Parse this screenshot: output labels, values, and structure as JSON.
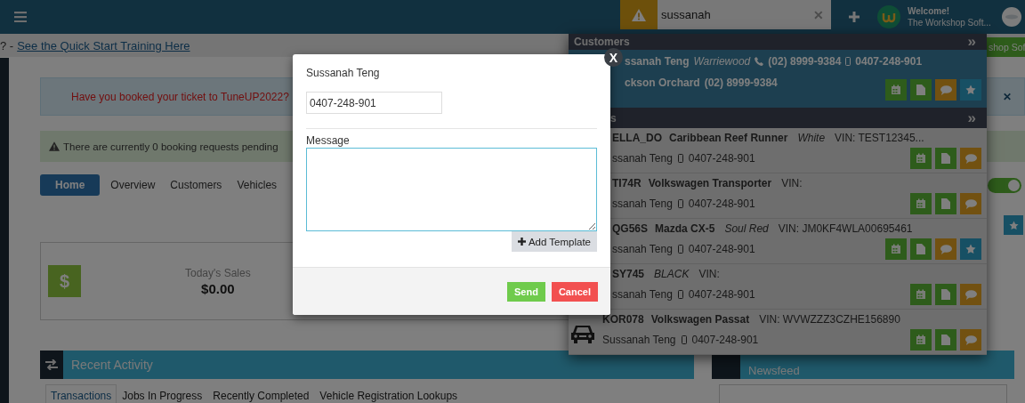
{
  "header": {
    "search": {
      "value": "sussanah",
      "clear": "✕"
    },
    "welcome": "Welcome!",
    "organisation": "The Workshop Soft..."
  },
  "banner": {
    "prefix": "? -",
    "link": "See the Quick Start Training Here",
    "button": "shop Sof"
  },
  "alerts": [
    {
      "kind": "info",
      "text": "Have you booked your ticket to TuneUP2022?",
      "close": "✕"
    },
    {
      "kind": "success",
      "text": "There are currently 0 booking requests pending"
    }
  ],
  "tabs": [
    {
      "label": "Home",
      "selected": true
    },
    {
      "label": "Overview",
      "selected": false
    },
    {
      "label": "Customers",
      "selected": false
    },
    {
      "label": "Vehicles",
      "selected": false
    }
  ],
  "toggle": {
    "on": true
  },
  "sales": {
    "icon": "$",
    "label": "Today's Sales",
    "value": "$0.00"
  },
  "recent_activity": {
    "title": "Recent Activity",
    "tabs": [
      {
        "label": "Transactions",
        "selected": true
      },
      {
        "label": "Jobs In Progress",
        "selected": false
      },
      {
        "label": "Recently Completed",
        "selected": false
      },
      {
        "label": "Vehicle Registration Lookups",
        "selected": false
      }
    ]
  },
  "newsfeed": {
    "title": "Newsfeed"
  },
  "dropdown": {
    "sections": [
      {
        "title": "Customers",
        "expand": "»",
        "kind": "customers",
        "rows": [
          {
            "selected": true,
            "name": "ssanah Teng",
            "suburb": "Warriewood",
            "phone": "(02) 8999-9384",
            "mobile": "0407-248-901",
            "contact": "ckson Orchard",
            "contact_phone": "(02) 8999-9384",
            "actions": [
              {
                "kind": "calendar"
              },
              {
                "kind": "document"
              },
              {
                "kind": "chat"
              },
              {
                "kind": "star"
              }
            ]
          }
        ]
      },
      {
        "title": "s",
        "expand": "»",
        "kind": "vehicles",
        "rows": [
          {
            "selected": false,
            "car_icon": false,
            "rego": "ELLA_DO",
            "model": "Caribbean Reef Runner",
            "colour": "White",
            "vin": "VIN: TEST12345...",
            "owner": "ssanah Teng",
            "mobile": "0407-248-901",
            "actions": [
              {
                "kind": "calendar"
              },
              {
                "kind": "document"
              },
              {
                "kind": "chat"
              }
            ]
          },
          {
            "selected": false,
            "car_icon": false,
            "rego": "TI74R",
            "model": "Volkswagen Transporter",
            "vin": "VIN:",
            "owner": "ssanah Teng",
            "mobile": "0407-248-901",
            "actions": [
              {
                "kind": "calendar"
              },
              {
                "kind": "document"
              },
              {
                "kind": "chat"
              }
            ]
          },
          {
            "selected": false,
            "car_icon": false,
            "rego": "QG56S",
            "model": "Mazda CX-5",
            "colour": "Soul Red",
            "vin": "VIN: JM0KF4WLA00695461",
            "owner": "ssanah Teng",
            "mobile": "0407-248-901",
            "actions": [
              {
                "kind": "calendar"
              },
              {
                "kind": "document"
              },
              {
                "kind": "chat"
              },
              {
                "kind": "star"
              }
            ]
          },
          {
            "selected": false,
            "car_icon": false,
            "rego": "SY745",
            "colour": "BLACK",
            "vin": "VIN:",
            "owner": "ssanah Teng",
            "mobile": "0407-248-901",
            "actions": [
              {
                "kind": "calendar"
              },
              {
                "kind": "document"
              },
              {
                "kind": "chat"
              }
            ]
          },
          {
            "selected": false,
            "car_icon": true,
            "rego": "KOR078",
            "model": "Volkswagen Passat",
            "vin": "VIN: WVWZZZ3CZHE156890",
            "owner": "Sussanah Teng",
            "mobile": "0407-248-901",
            "actions": [
              {
                "kind": "calendar"
              },
              {
                "kind": "document"
              },
              {
                "kind": "chat"
              }
            ]
          }
        ]
      }
    ]
  },
  "modal": {
    "close": "X",
    "recipient": "Sussanah Teng",
    "number": "0407-248-901",
    "message_label": "Message",
    "add_template": "Add Template",
    "buttons": [
      {
        "kind": "send",
        "label": "Send"
      },
      {
        "kind": "cancel",
        "label": "Cancel"
      }
    ]
  }
}
